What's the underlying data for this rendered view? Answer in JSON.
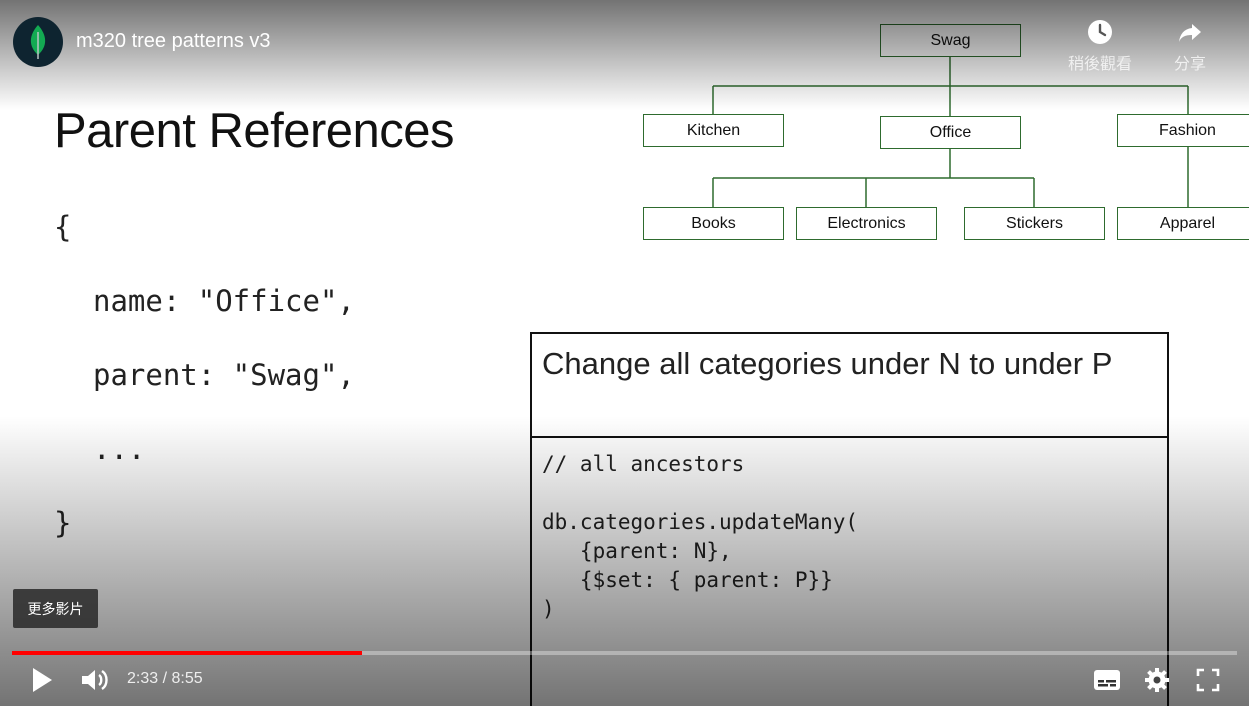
{
  "video": {
    "title": "m320 tree patterns v3",
    "channel_icon": "mongodb-leaf-icon"
  },
  "top_actions": {
    "watch_later_label": "稍後觀看",
    "share_label": "分享"
  },
  "slide": {
    "title": "Parent References",
    "code_left": [
      "{",
      "name: \"Office\",",
      "parent: \"Swag\",",
      "...",
      "}"
    ],
    "tree": {
      "root": "Swag",
      "level1": [
        "Kitchen",
        "Office",
        "Fashion"
      ],
      "level2": [
        "Books",
        "Electronics",
        "Stickers",
        "Apparel"
      ]
    },
    "box": {
      "heading": "Change all categories under N to under P",
      "code_lines": [
        "// all ancestors",
        "",
        "db.categories.updateMany(",
        "   {parent: N},",
        "   {$set: { parent: P}}",
        ")"
      ]
    }
  },
  "more_videos_label": "更多影片",
  "controls": {
    "time": "2:33 / 8:55",
    "progress": 0.286,
    "accent_color": "#ff0000"
  }
}
